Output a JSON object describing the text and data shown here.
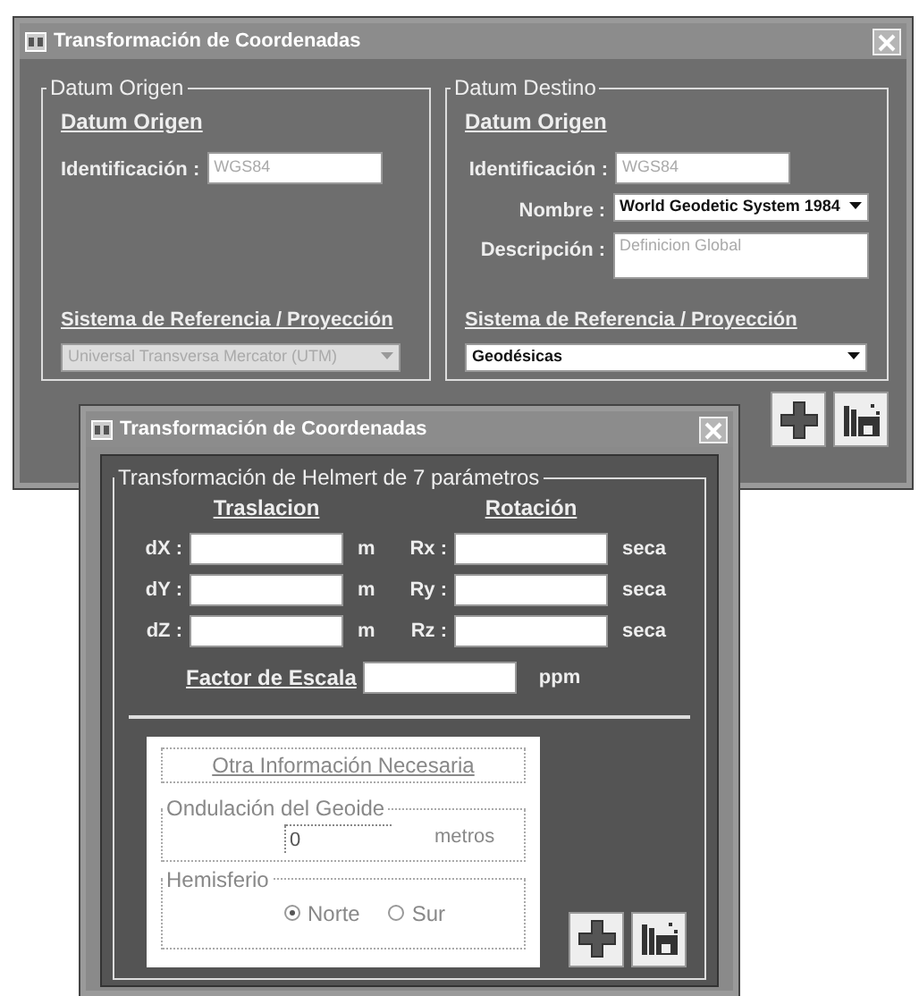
{
  "main_window": {
    "title": "Transformación de Coordenadas",
    "groups": [
      {
        "title": "Datum Origen",
        "heading": "Datum Origen",
        "fields": [
          {
            "kind": "text",
            "label": "Identificación :",
            "value": "WGS84",
            "disabled": true
          }
        ],
        "system_heading": "Sistema de Referencia / Proyección",
        "system": {
          "value": "Universal Transversa Mercator (UTM)",
          "disabled": true
        }
      },
      {
        "title": "Datum Destino",
        "heading": "Datum Origen",
        "fields": [
          {
            "kind": "text",
            "label": "Identificación :",
            "value": "WGS84",
            "disabled": true
          },
          {
            "kind": "select",
            "label": "Nombre :",
            "value": "World Geodetic System 1984",
            "disabled": false
          },
          {
            "kind": "textarea",
            "label": "Descripción :",
            "value": "Definicion Global",
            "disabled": true
          }
        ],
        "system_heading": "Sistema de Referencia / Proyección",
        "system": {
          "value": "Geodésicas",
          "disabled": false
        }
      }
    ],
    "buttons": [
      {
        "kind": "add"
      },
      {
        "kind": "save"
      }
    ]
  },
  "helmert_window": {
    "title": "Transformación de Coordenadas",
    "group_title": "Transformación de Helmert de 7 parámetros",
    "translation_heading": "Traslacion",
    "rotation_heading": "Rotación",
    "rows": [
      {
        "label": "dX :",
        "unit": "m",
        "rotation_label": "Rx :",
        "rotation_unit": "seca"
      },
      {
        "label": "dY :",
        "unit": "m",
        "rotation_label": "Ry :",
        "rotation_unit": "seca"
      },
      {
        "label": "dZ :",
        "unit": "m",
        "rotation_label": "Rz :",
        "rotation_unit": "seca"
      }
    ],
    "scale": {
      "label": "Factor de Escala",
      "unit": "ppm"
    },
    "other_info": {
      "title": "Otra Información Necesaria",
      "geoid": {
        "title": "Ondulación del Geoide",
        "value": "0",
        "unit": "metros"
      },
      "hemisphere": {
        "title": "Hemisferio",
        "options": [
          {
            "label": "Norte",
            "selected": true
          },
          {
            "label": "Sur",
            "selected": false
          }
        ]
      }
    },
    "buttons": [
      {
        "kind": "add"
      },
      {
        "kind": "save"
      }
    ]
  }
}
